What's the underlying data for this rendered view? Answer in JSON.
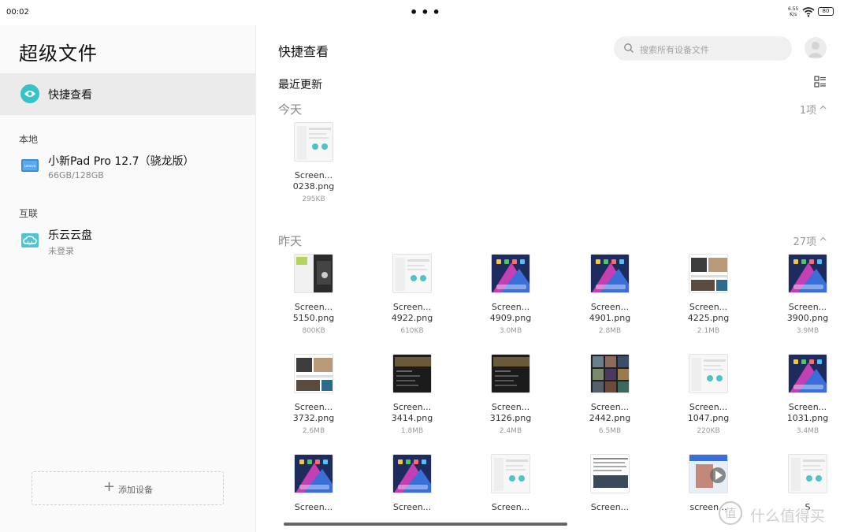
{
  "status": {
    "time": "00:02",
    "dots": "•••",
    "speed_top": "6.55",
    "speed_bottom": "K/s",
    "battery": "80"
  },
  "sidebar": {
    "app_title": "超级文件",
    "quick_view": "快捷查看",
    "local_label": "本地",
    "local_device": {
      "name": "小新Pad Pro 12.7（骁龙版）",
      "storage": "66GB/128GB",
      "logo": "Lenovo"
    },
    "connect_label": "互联",
    "cloud": {
      "name": "乐云云盘",
      "status": "未登录"
    },
    "add_device": {
      "plus": "+",
      "label": "添加设备"
    }
  },
  "main": {
    "title": "快捷查看",
    "search_placeholder": "搜索所有设备文件",
    "recent_title": "最近更新",
    "today": {
      "label": "今天",
      "count": "1项",
      "chevron": "^"
    },
    "yesterday": {
      "label": "昨天",
      "count": "27项",
      "chevron": "^"
    },
    "today_files": [
      {
        "name1": "Screen...",
        "name2": "0238.png",
        "size": "295KB",
        "theme": "light"
      }
    ],
    "yesterday_files": [
      {
        "name1": "Screen...",
        "name2": "5150.png",
        "size": "800KB",
        "theme": "mixed"
      },
      {
        "name1": "Screen...",
        "name2": "4922.png",
        "size": "610KB",
        "theme": "light"
      },
      {
        "name1": "Screen...",
        "name2": "4909.png",
        "size": "3.0MB",
        "theme": "wall"
      },
      {
        "name1": "Screen...",
        "name2": "4901.png",
        "size": "2.8MB",
        "theme": "wall"
      },
      {
        "name1": "Screen...",
        "name2": "4225.png",
        "size": "2.1MB",
        "theme": "photo"
      },
      {
        "name1": "Screen...",
        "name2": "3900.png",
        "size": "3.9MB",
        "theme": "wall"
      },
      {
        "name1": "Screen...",
        "name2": "3732.png",
        "size": "2.6MB",
        "theme": "photo"
      },
      {
        "name1": "Screen...",
        "name2": "3414.png",
        "size": "1.8MB",
        "theme": "dark"
      },
      {
        "name1": "Screen...",
        "name2": "3126.png",
        "size": "2.4MB",
        "theme": "dark"
      },
      {
        "name1": "Screen...",
        "name2": "2442.png",
        "size": "6.5MB",
        "theme": "grid"
      },
      {
        "name1": "Screen...",
        "name2": "1047.png",
        "size": "220KB",
        "theme": "light"
      },
      {
        "name1": "Screen...",
        "name2": "1031.png",
        "size": "3.4MB",
        "theme": "wall"
      },
      {
        "name1": "Screen...",
        "name2": "",
        "size": "",
        "theme": "wall"
      },
      {
        "name1": "Screen...",
        "name2": "",
        "size": "",
        "theme": "wall"
      },
      {
        "name1": "Screen...",
        "name2": "",
        "size": "",
        "theme": "light"
      },
      {
        "name1": "Screen...",
        "name2": "",
        "size": "",
        "theme": "doc"
      },
      {
        "name1": "screen...",
        "name2": "",
        "size": "",
        "theme": "video"
      },
      {
        "name1": "S",
        "name2": "",
        "size": "",
        "theme": "light"
      }
    ]
  },
  "watermark": {
    "logo": "值",
    "text": "什么值得买"
  }
}
